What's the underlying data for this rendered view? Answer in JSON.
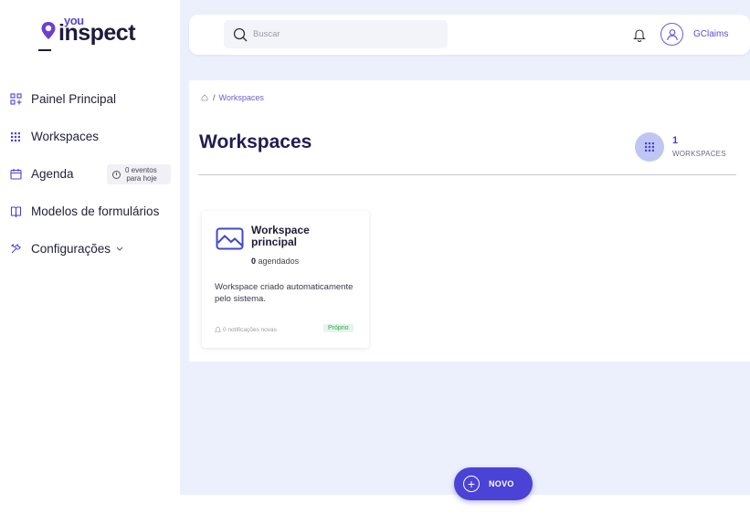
{
  "brand": {
    "you": "you",
    "inspect": "inspect"
  },
  "sidebar": {
    "items": [
      {
        "label": "Painel Principal",
        "icon": "dashboard-icon"
      },
      {
        "label": "Workspaces",
        "icon": "grid-icon"
      },
      {
        "label": "Agenda",
        "icon": "calendar-icon",
        "badge_line1": "0 eventos",
        "badge_line2": "para hoje"
      },
      {
        "label": "Modelos de formulários",
        "icon": "book-icon"
      },
      {
        "label": "Configurações",
        "icon": "tools-icon"
      }
    ]
  },
  "header": {
    "search_placeholder": "Buscar",
    "username": "GClaims"
  },
  "breadcrumb": {
    "current": "Workspaces",
    "separator": "/"
  },
  "page": {
    "title": "Workspaces",
    "count": "1",
    "count_label": "WORKSPACES"
  },
  "workspaces": [
    {
      "title": "Workspace principal",
      "scheduled_count": "0",
      "scheduled_label": "agendados",
      "description": "Workspace criado automaticamente pelo sistema.",
      "notifications": "0 notificações novas",
      "tag": "Próprio"
    }
  ],
  "fab": {
    "label": "NOVO"
  },
  "colors": {
    "accent": "#4b42d6",
    "background": "#ecf0fc",
    "title": "#221c52",
    "tag_bg": "#e4f6e8",
    "tag_text": "#3aa05a"
  }
}
